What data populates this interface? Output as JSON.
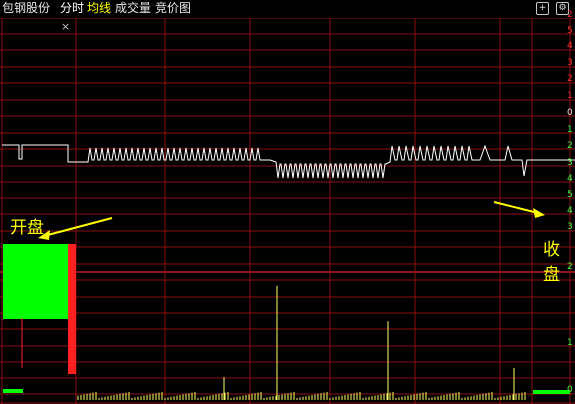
{
  "header": {
    "stock_name": "包钢股份",
    "tabs": [
      "分时",
      "均线",
      "成交量",
      "竞价图"
    ],
    "controls": {
      "plus": "+",
      "settings": "⚙"
    }
  },
  "annotations": {
    "open": "开盘",
    "close_line1": "收",
    "close_line2": "盘"
  },
  "chart_panel": {
    "close_glyph": "×"
  },
  "right_scale": [
    {
      "text": "2",
      "color": "#ff3030"
    },
    {
      "text": "5",
      "color": "#ff3030"
    },
    {
      "text": "4",
      "color": "#ff3030"
    },
    {
      "text": "3",
      "color": "#ff3030"
    },
    {
      "text": "2",
      "color": "#ff3030"
    },
    {
      "text": "1",
      "color": "#ff3030"
    },
    {
      "text": "0",
      "color": "#e0e0e0"
    },
    {
      "text": "1",
      "color": "#3cff3c"
    },
    {
      "text": "2",
      "color": "#3cff3c"
    },
    {
      "text": "3",
      "color": "#3cff3c"
    },
    {
      "text": "4",
      "color": "#3cff3c"
    },
    {
      "text": "5",
      "color": "#3cff3c"
    },
    {
      "text": "4",
      "color": "#3cff3c"
    },
    {
      "text": "3",
      "color": "#3cff3c"
    },
    {
      "text": "2",
      "color": "#3cff3c"
    },
    {
      "text": "1",
      "color": "#3cff3c"
    },
    {
      "text": "0",
      "color": "#3cff3c"
    }
  ],
  "colors": {
    "background": "#000000",
    "grid": "#8a1010",
    "divider": "#c02020",
    "price_line": "#ffffff",
    "auction_up": "#ff2020",
    "auction_down": "#00ff00",
    "volume": "#ffff66",
    "annotation": "#ffff00"
  },
  "chart_data": {
    "type": "line",
    "segments": [
      "pre-open auction",
      "continuous trading",
      "closing auction"
    ],
    "price_level_ticks": 21,
    "volume_spikes": [
      {
        "slot": 1,
        "level": 0.18
      },
      {
        "slot": 2,
        "level": 0.9
      },
      {
        "slot": 3,
        "level": 0.62
      }
    ]
  }
}
